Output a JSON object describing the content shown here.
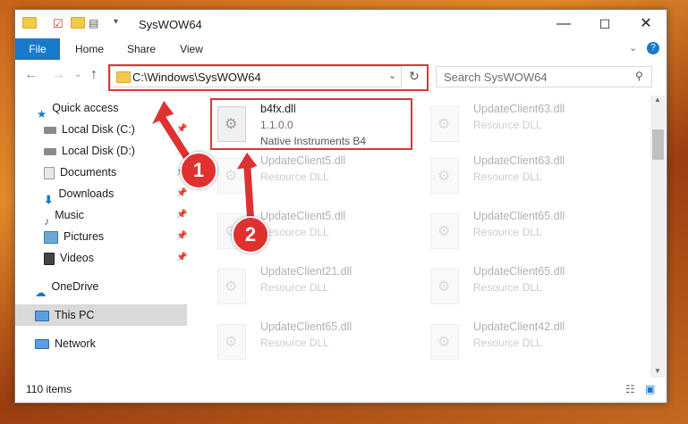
{
  "window": {
    "title": "SysWOW64",
    "controls": {
      "minimize": "—",
      "maximize": "☐",
      "close": "✕"
    }
  },
  "ribbon": {
    "tabs": [
      "File",
      "Home",
      "Share",
      "View"
    ]
  },
  "address_bar": {
    "path": "C:\\Windows\\SysWOW64"
  },
  "search": {
    "placeholder": "Search SysWOW64"
  },
  "sidebar": {
    "items": [
      {
        "label": "Quick access",
        "icon": "star-icon",
        "pinned": false
      },
      {
        "label": "Local Disk (C:)",
        "icon": "drive-icon",
        "pinned": true
      },
      {
        "label": "Local Disk (D:)",
        "icon": "drive-icon",
        "pinned": true
      },
      {
        "label": "Documents",
        "icon": "documents-icon",
        "pinned": true
      },
      {
        "label": "Downloads",
        "icon": "download-icon",
        "pinned": true
      },
      {
        "label": "Music",
        "icon": "music-icon",
        "pinned": true
      },
      {
        "label": "Pictures",
        "icon": "pictures-icon",
        "pinned": true
      },
      {
        "label": "Videos",
        "icon": "videos-icon",
        "pinned": true
      },
      {
        "label": "OneDrive",
        "icon": "cloud-icon",
        "pinned": false
      },
      {
        "label": "This PC",
        "icon": "computer-icon",
        "pinned": false,
        "selected": true
      },
      {
        "label": "Network",
        "icon": "network-icon",
        "pinned": false
      }
    ]
  },
  "files": {
    "highlighted": {
      "name": "b4fx.dll",
      "version": "1.1.0.0",
      "description": "Native Instruments B4"
    },
    "left_column": [
      {
        "name": "UpdateClient5.dll",
        "type": "Resource DLL"
      },
      {
        "name": "UpdateClient5.dll",
        "type": "Resource DLL"
      },
      {
        "name": "UpdateClient21.dll",
        "type": "Resource DLL"
      },
      {
        "name": "UpdateClient65.dll",
        "type": "Resource DLL"
      }
    ],
    "right_column": [
      {
        "name": "UpdateClient63.dll",
        "type": "Resource DLL"
      },
      {
        "name": "UpdateClient63.dll",
        "type": "Resource DLL"
      },
      {
        "name": "UpdateClient65.dll",
        "type": "Resource DLL"
      },
      {
        "name": "UpdateClient65.dll",
        "type": "Resource DLL"
      },
      {
        "name": "UpdateClient42.dll",
        "type": "Resource DLL"
      }
    ]
  },
  "status_bar": {
    "item_count": "110 items"
  },
  "annotations": {
    "step1": "1",
    "step2": "2",
    "color": "#e03131"
  }
}
